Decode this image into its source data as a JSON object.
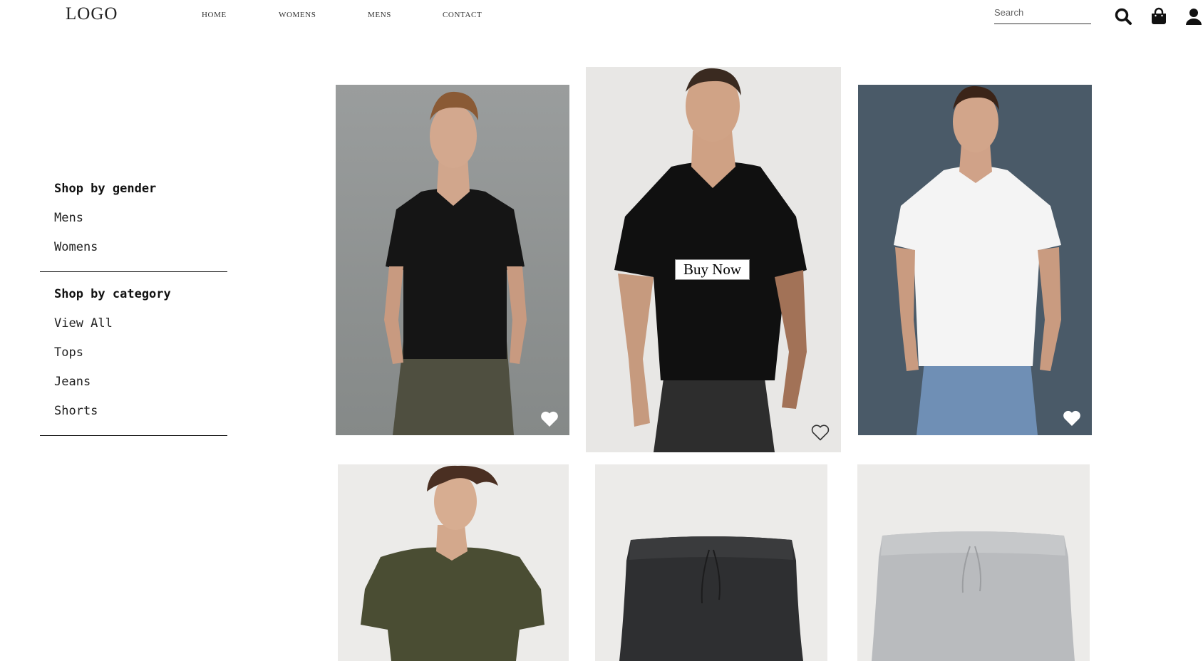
{
  "header": {
    "logo": "LOGO",
    "nav": [
      "HOME",
      "WOMENS",
      "MENS",
      "CONTACT"
    ],
    "search_placeholder": "Search",
    "icons": [
      "search-icon",
      "shopping-bag-icon",
      "user-icon"
    ]
  },
  "sidebar": {
    "gender_heading": "Shop by gender",
    "gender_items": [
      "Mens",
      "Womens"
    ],
    "category_heading": "Shop by category",
    "category_items": [
      "View All",
      "Tops",
      "Jeans",
      "Shorts"
    ]
  },
  "products": {
    "buy_now_label": "Buy Now",
    "items": [
      {
        "image": "man in black v-neck t-shirt and olive trousers",
        "favorite": "filled-heart-icon"
      },
      {
        "image": "man in black v-neck t-shirt with tattooed arm",
        "favorite": "outline-heart-icon"
      },
      {
        "image": "man in white crew-neck t-shirt and jeans",
        "favorite": "filled-heart-icon"
      },
      {
        "image": "young man in olive green t-shirt"
      },
      {
        "image": "dark grey sweat shorts"
      },
      {
        "image": "light grey sweat shorts"
      }
    ]
  },
  "colors": {
    "text": "#111111",
    "card1_bg": "#909394",
    "card2_bg": "#e8e7e5",
    "card3_bg": "#4a5a68",
    "card_light_bg": "#ecebe9"
  }
}
